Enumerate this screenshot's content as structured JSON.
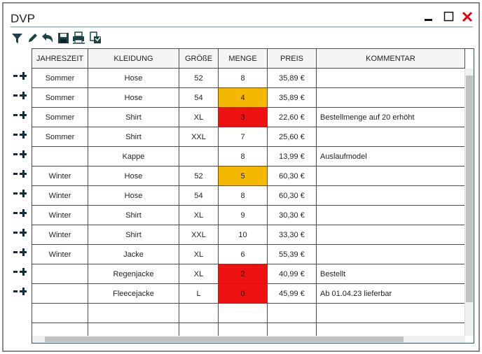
{
  "window": {
    "title": "DVP"
  },
  "toolbar": [
    "filter-icon",
    "edit-pencil-icon",
    "undo-icon",
    "save-icon",
    "print-icon",
    "print-preview-icon"
  ],
  "columns": [
    "JAHRESZEIT",
    "KLEIDUNG",
    "GRÖßE",
    "MENGE",
    "PREIS",
    "KOMMENTAR"
  ],
  "status_colors": {
    "warn": "#f5b800",
    "bad": "#ee1111"
  },
  "rows": [
    {
      "jahreszeit": "Sommer",
      "kleidung": "Hose",
      "groesse": "52",
      "menge": "8",
      "preis": "35,89 €",
      "kommentar": "",
      "status": ""
    },
    {
      "jahreszeit": "Sommer",
      "kleidung": "Hose",
      "groesse": "54",
      "menge": "4",
      "preis": "35,89 €",
      "kommentar": "",
      "status": "warn"
    },
    {
      "jahreszeit": "Sommer",
      "kleidung": "Shirt",
      "groesse": "XL",
      "menge": "3",
      "preis": "22,60 €",
      "kommentar": "Bestellmenge auf 20 erhöht",
      "status": "bad"
    },
    {
      "jahreszeit": "Sommer",
      "kleidung": "Shirt",
      "groesse": "XXL",
      "menge": "7",
      "preis": "25,60 €",
      "kommentar": "",
      "status": ""
    },
    {
      "jahreszeit": "",
      "kleidung": "Kappe",
      "groesse": "",
      "menge": "8",
      "preis": "13,99 €",
      "kommentar": "Auslaufmodel",
      "status": ""
    },
    {
      "jahreszeit": "Winter",
      "kleidung": "Hose",
      "groesse": "52",
      "menge": "5",
      "preis": "60,30 €",
      "kommentar": "",
      "status": "warn"
    },
    {
      "jahreszeit": "Winter",
      "kleidung": "Hose",
      "groesse": "54",
      "menge": "8",
      "preis": "60,30 €",
      "kommentar": "",
      "status": ""
    },
    {
      "jahreszeit": "Winter",
      "kleidung": "Shirt",
      "groesse": "XL",
      "menge": "9",
      "preis": "30,30 €",
      "kommentar": "",
      "status": ""
    },
    {
      "jahreszeit": "Winter",
      "kleidung": "Shirt",
      "groesse": "XXL",
      "menge": "10",
      "preis": "33,30 €",
      "kommentar": "",
      "status": ""
    },
    {
      "jahreszeit": "Winter",
      "kleidung": "Jacke",
      "groesse": "XL",
      "menge": "6",
      "preis": "55,39 €",
      "kommentar": "",
      "status": ""
    },
    {
      "jahreszeit": "",
      "kleidung": "Regenjacke",
      "groesse": "XL",
      "menge": "2",
      "preis": "40,99 €",
      "kommentar": "Bestellt",
      "status": "bad"
    },
    {
      "jahreszeit": "",
      "kleidung": "Fleecejacke",
      "groesse": "L",
      "menge": "0",
      "preis": "45,99 €",
      "kommentar": "Ab 01.04.23 lieferbar",
      "status": "bad"
    },
    {
      "jahreszeit": "",
      "kleidung": "",
      "groesse": "",
      "menge": "",
      "preis": "",
      "kommentar": "",
      "status": ""
    },
    {
      "jahreszeit": "",
      "kleidung": "",
      "groesse": "",
      "menge": "",
      "preis": "",
      "kommentar": "",
      "status": ""
    }
  ]
}
